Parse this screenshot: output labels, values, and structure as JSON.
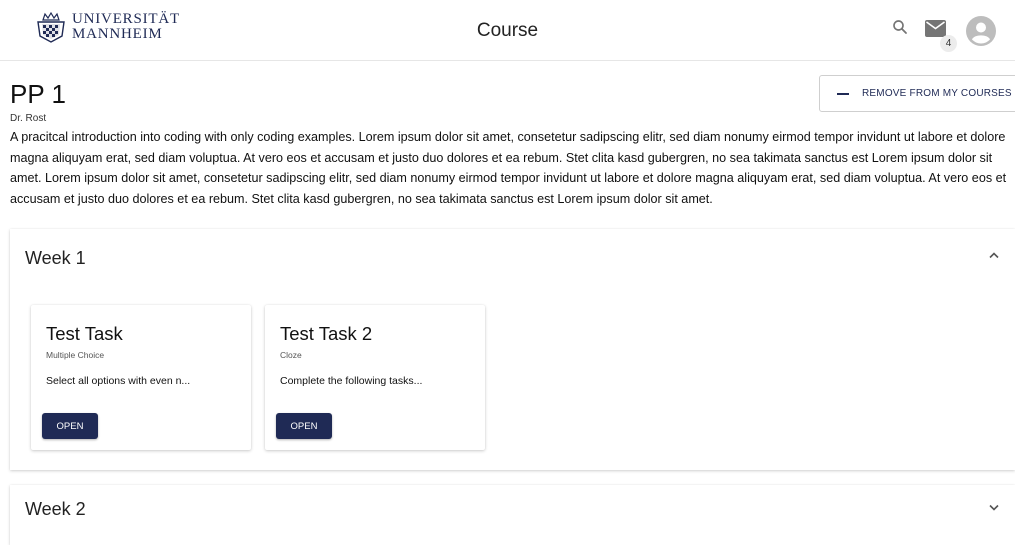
{
  "header": {
    "logo_line1": "UNIVERSITÄT",
    "logo_line2": "MANNHEIM",
    "title": "Course",
    "mail_badge": "4",
    "search_icon": "search-icon",
    "mail_icon": "mail-icon",
    "avatar_icon": "account-circle-icon"
  },
  "course": {
    "title": "PP 1",
    "teacher": "Dr. Rost",
    "description": "A pracitcal introduction into coding with only coding examples. Lorem ipsum dolor sit amet, consetetur sadipscing elitr, sed diam nonumy eirmod tempor invidunt ut labore et dolore magna aliquyam erat, sed diam voluptua. At vero eos et accusam et justo duo dolores et ea rebum. Stet clita kasd gubergren, no sea takimata sanctus est Lorem ipsum dolor sit amet. Lorem ipsum dolor sit amet, consetetur sadipscing elitr, sed diam nonumy eirmod tempor invidunt ut labore et dolore magna aliquyam erat, sed diam voluptua. At vero eos et accusam et justo duo dolores et ea rebum. Stet clita kasd gubergren, no sea takimata sanctus est Lorem ipsum dolor sit amet.",
    "remove_button": "REMOVE FROM MY COURSES"
  },
  "weeks": [
    {
      "title": "Week 1",
      "expanded": true,
      "tasks": [
        {
          "title": "Test Task",
          "type": "Multiple Choice",
          "description": "Select all options with even n...",
          "button": "OPEN"
        },
        {
          "title": "Test Task 2",
          "type": "Cloze",
          "description": "Complete the following tasks...",
          "button": "OPEN"
        }
      ]
    },
    {
      "title": "Week 2",
      "expanded": false
    }
  ],
  "colors": {
    "brand": "#1f2a55",
    "icon_gray": "#757575"
  }
}
